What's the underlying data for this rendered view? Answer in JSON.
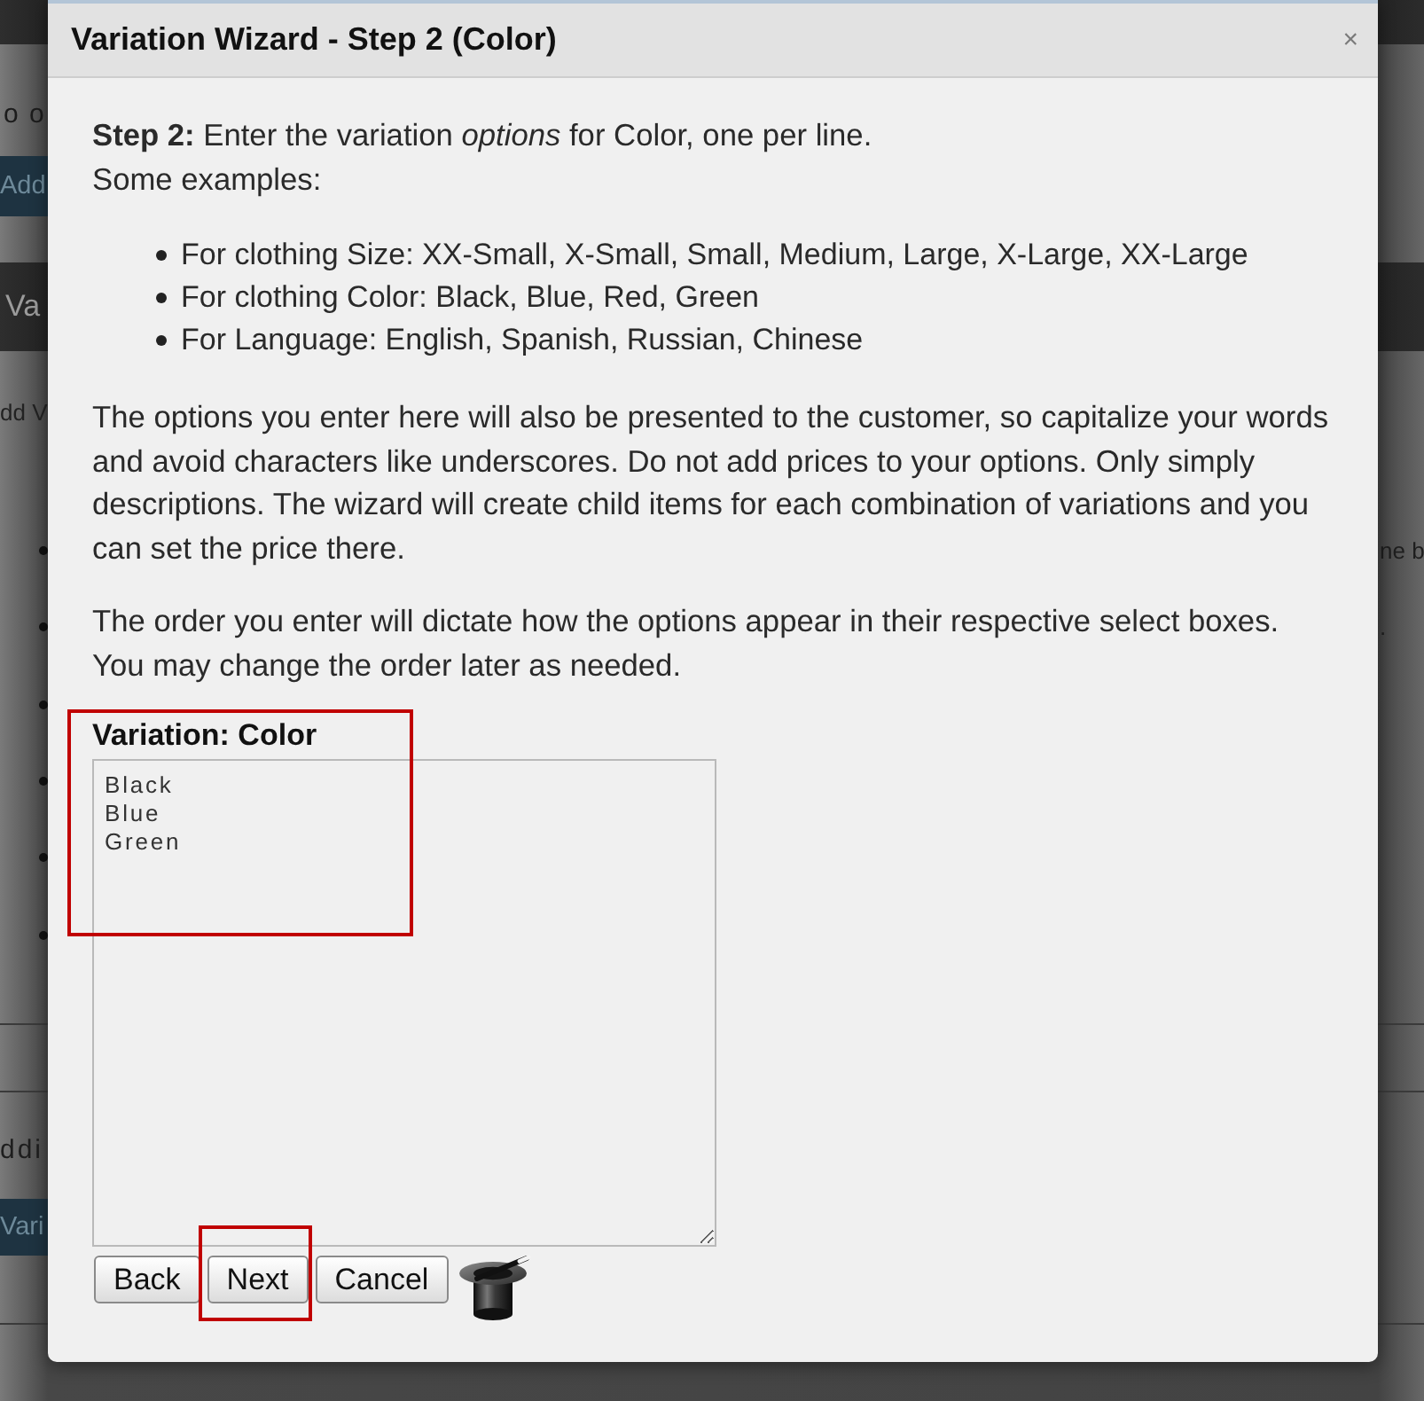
{
  "background_page": {
    "top_text": "o o",
    "add_button": "Add",
    "panel_title": "Va",
    "link": "dd V",
    "right_texts": [
      "ne b",
      "."
    ],
    "footer_text": "ddi",
    "footer_button": "Vari"
  },
  "dialog": {
    "title": "Variation Wizard - Step 2 (Color)",
    "close": "×",
    "intro_lines": [
      "**Step 2:** Enter the variation *options* for Color, one per line.",
      "Some examples:"
    ],
    "examples": [
      "For clothing Size: XX-Small, X-Small, Small, Medium, Large, X-Large, XX-Large",
      "For clothing Color: Black, Blue, Red, Green",
      "For Language: English, Spanish, Russian, Chinese"
    ],
    "paragraphs": [
      "The options you enter here will also be presented to the customer, so capitalize your words and avoid characters like underscores. Do not add prices to your options. Only simply descriptions. The wizard will create child items for each combination of variations and you can set the price there.",
      "The order you enter will dictate how the options appear in their respective select boxes. You may change the order later as needed."
    ],
    "field": {
      "label": "Variation: Color",
      "value": "Black\nBlue\nGreen",
      "highlighted": true
    },
    "buttons": [
      {
        "label": "Back",
        "highlighted": false
      },
      {
        "label": "Next",
        "highlighted": true
      },
      {
        "label": "Cancel",
        "highlighted": false
      }
    ]
  }
}
